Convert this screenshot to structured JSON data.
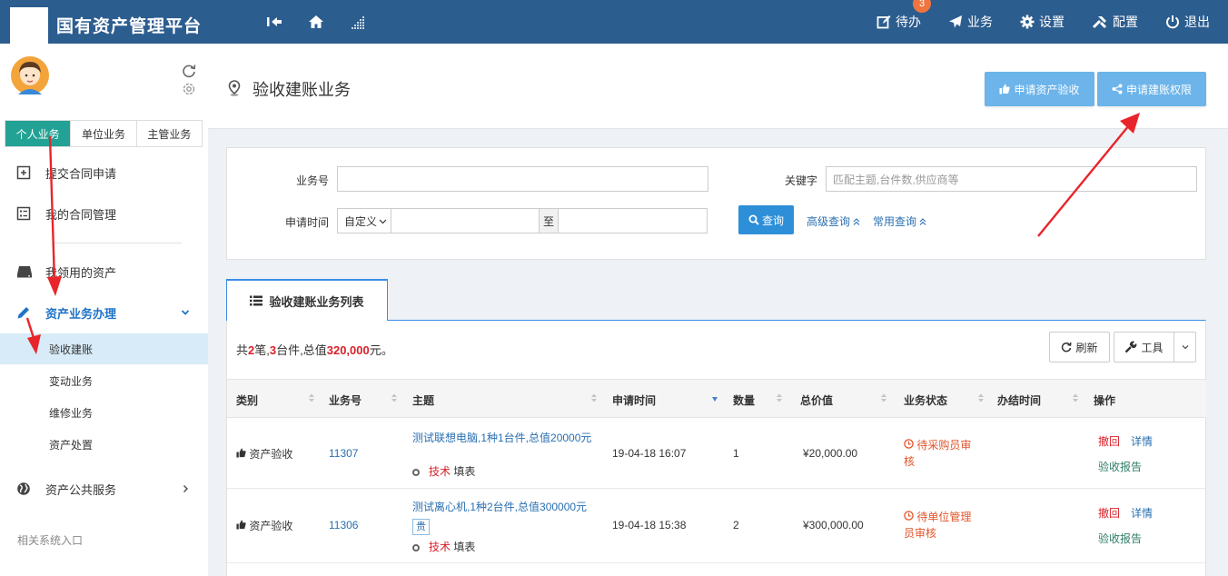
{
  "app": {
    "title": "国有资产管理平台"
  },
  "topnav": {
    "todo": "待办",
    "todo_badge": "3",
    "business": "业务",
    "settings": "设置",
    "config": "配置",
    "logout": "退出"
  },
  "sidebar": {
    "tabs": [
      "个人业务",
      "单位业务",
      "主管业务"
    ],
    "items": [
      {
        "label": "提交合同申请",
        "icon": "document-plus-icon"
      },
      {
        "label": "我的合同管理",
        "icon": "list-icon"
      },
      {
        "label": "我领用的资产",
        "icon": "drive-icon"
      },
      {
        "label": "资产业务办理",
        "icon": "pencil-icon"
      },
      {
        "label": "资产公共服务",
        "icon": "globe-icon"
      }
    ],
    "subitems": [
      "验收建账",
      "变动业务",
      "维修业务",
      "资产处置"
    ],
    "related": "相关系统入口"
  },
  "page": {
    "title": "验收建账业务",
    "btn_apply_accept": "申请资产验收",
    "btn_apply_perm": "申请建账权限"
  },
  "search": {
    "biz_no_label": "业务号",
    "keyword_label": "关键字",
    "keyword_placeholder": "匹配主题,台件数,供应商等",
    "time_label": "申请时间",
    "time_mode": "自定义",
    "to": "至",
    "query": "查询",
    "advanced": "高级查询",
    "common": "常用查询"
  },
  "list": {
    "tab_title": "验收建账业务列表",
    "summary": {
      "pre": "共",
      "count": "2",
      "mid1": "笔,",
      "units": "3",
      "mid2": "台件,总值",
      "total": "320,000",
      "post": "元。"
    },
    "refresh": "刷新",
    "tools": "工具",
    "headers": [
      "类别",
      "业务号",
      "主题",
      "申请时间",
      "数量",
      "总价值",
      "业务状态",
      "办结时间",
      "操作"
    ],
    "rows": [
      {
        "category": "资产验收",
        "biz_no": "11307",
        "subject": "测试联想电脑,1种1台件,总值20000元",
        "tag": "",
        "applicant_dept": "技术",
        "applicant_role": "填表",
        "time": "19-04-18 16:07",
        "qty": "1",
        "value": "¥20,000.00",
        "state_line1": "待采购员审",
        "state_line2": "核",
        "finish": "",
        "op_revoke": "撤回",
        "op_detail": "详情",
        "op_report": "验收报告"
      },
      {
        "category": "资产验收",
        "biz_no": "11306",
        "subject": "测试离心机,1种2台件,总值300000元",
        "tag": "贵",
        "applicant_dept": "技术",
        "applicant_role": "填表",
        "time": "19-04-18 15:38",
        "qty": "2",
        "value": "¥300,000.00",
        "state_line1": "待单位管理",
        "state_line2": "员审核",
        "finish": "",
        "op_revoke": "撤回",
        "op_detail": "详情",
        "op_report": "验收报告"
      }
    ]
  }
}
